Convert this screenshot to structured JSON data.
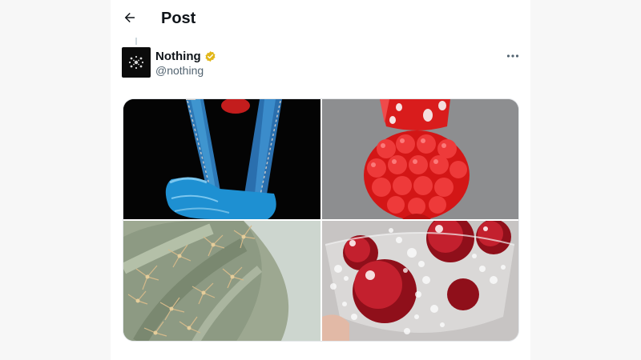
{
  "header": {
    "title": "Post",
    "back_icon": "arrow-left-icon"
  },
  "post": {
    "author": {
      "name": "Nothing",
      "handle": "@nothing",
      "verified_badge": "verified-gold-badge-icon",
      "verified_color": "#e2b719"
    },
    "more_icon": "more-horizontal-icon",
    "media": [
      {
        "subject": "blue peace-sign glove"
      },
      {
        "subject": "red gummy dice on raspberry"
      },
      {
        "subject": "cactus with spines"
      },
      {
        "subject": "cherries in fizzy glass"
      }
    ]
  },
  "colors": {
    "text_primary": "#0f1419",
    "text_secondary": "#536471",
    "background": "#ffffff"
  }
}
